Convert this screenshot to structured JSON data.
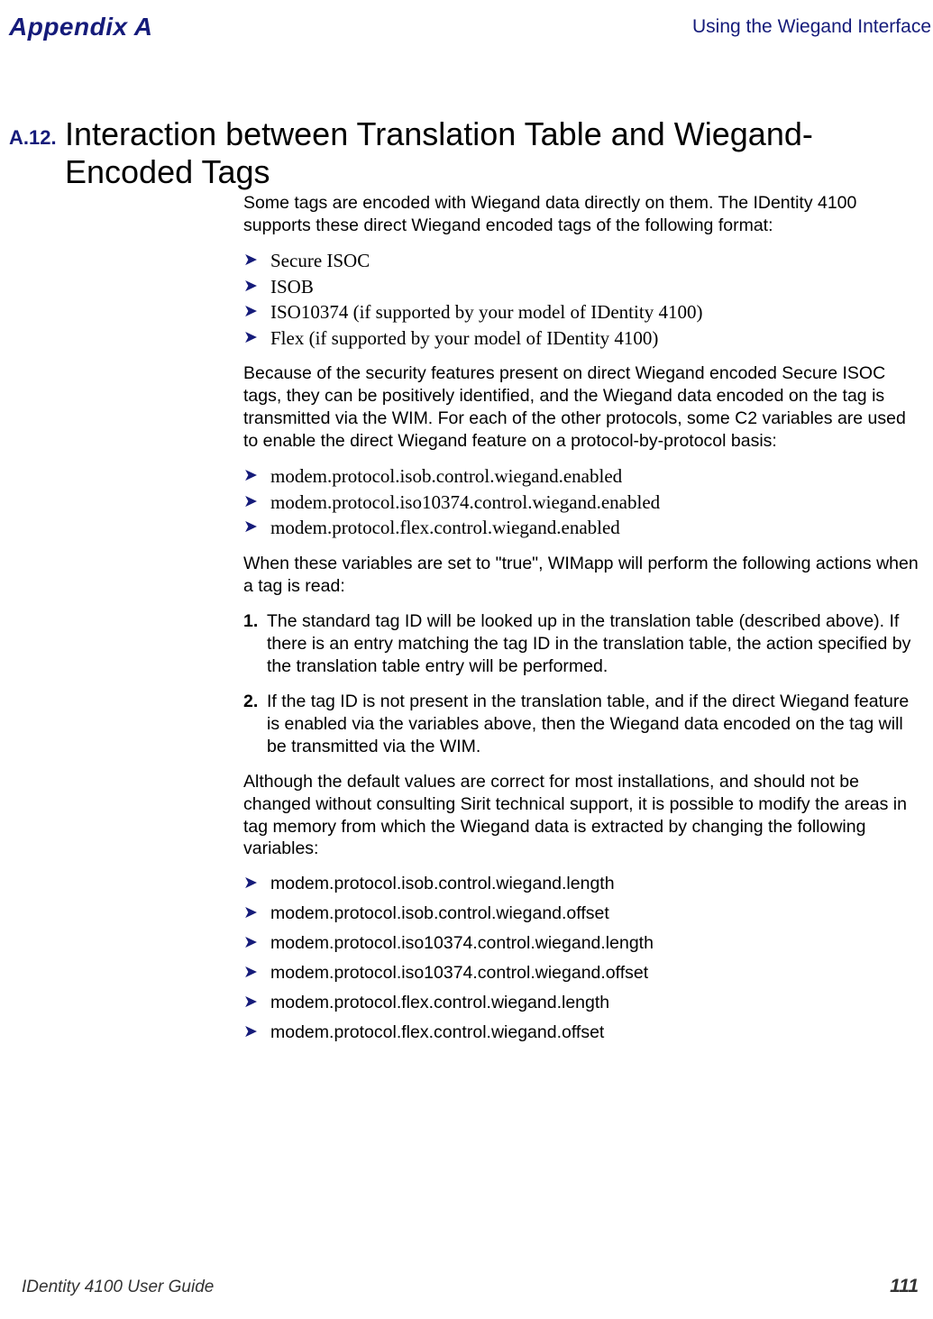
{
  "header": {
    "left": "Appendix A",
    "right": "Using the Wiegand Interface"
  },
  "section": {
    "number": "A.12.",
    "title": "Interaction between Translation Table and Wiegand-Encoded Tags"
  },
  "para1": "Some tags are encoded with Wiegand data directly on them.  The IDentity 4100 supports these direct Wiegand encoded tags of the following format:",
  "list1": [
    "Secure ISOC",
    "ISOB",
    "ISO10374  (if supported by your model of IDentity 4100)",
    "Flex (if supported by your model of IDentity 4100)"
  ],
  "para2": "Because of the security features present on direct Wiegand encoded Secure ISOC tags, they can be positively identified, and the Wiegand data encoded on the tag is transmitted via the WIM.  For each of the other protocols, some C2 variables are used to enable the direct Wiegand feature on a protocol-by-protocol basis:",
  "list2": [
    "modem.protocol.isob.control.wiegand.enabled",
    "modem.protocol.iso10374.control.wiegand.enabled",
    "modem.protocol.flex.control.wiegand.enabled"
  ],
  "para3": "When these variables are set to \"true\", WIMapp will perform the following actions when a tag is read:",
  "ol": [
    {
      "num": "1.",
      "text": "The standard tag ID will be looked up in the translation table (described above).  If there is an entry matching the tag ID in the translation table, the action specified by the translation table entry will be performed."
    },
    {
      "num": "2.",
      "text": "If the tag ID is not present in the translation table, and if the direct Wiegand feature is enabled via the variables above, then the Wiegand data encoded on the tag will be transmitted via the WIM."
    }
  ],
  "para4": "Although the default values are correct for most installations, and should not be changed without consulting Sirit technical support, it is possible to modify the areas in tag memory from which the Wiegand data is extracted by changing the following variables:",
  "list3": [
    "modem.protocol.isob.control.wiegand.length",
    "modem.protocol.isob.control.wiegand.offset",
    "modem.protocol.iso10374.control.wiegand.length",
    "modem.protocol.iso10374.control.wiegand.offset",
    "modem.protocol.flex.control.wiegand.length",
    "modem.protocol.flex.control.wiegand.offset"
  ],
  "footer": {
    "left": "IDentity 4100 User Guide",
    "right": "111"
  }
}
